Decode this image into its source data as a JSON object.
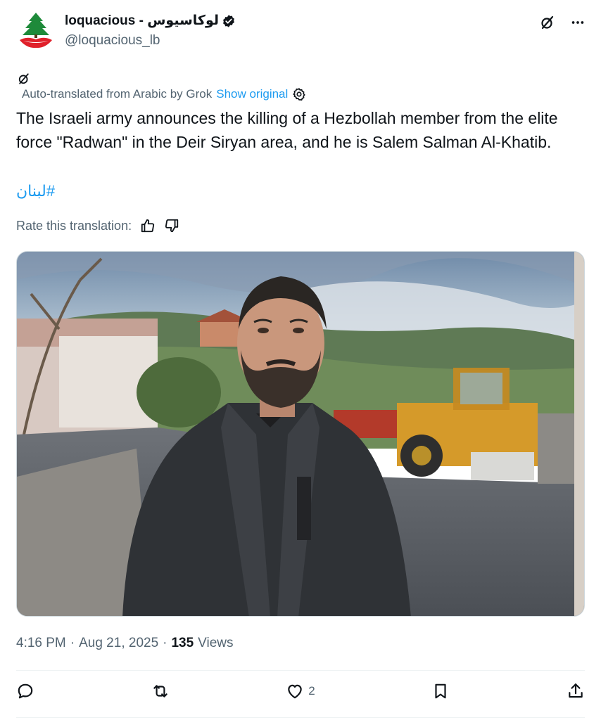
{
  "author": {
    "display_name": "loquacious - لوكاسيوس",
    "handle": "@loquacious_lb"
  },
  "icons": {
    "avatar": "lebanese-cedar-logo",
    "verified": "verified-badge-icon",
    "grok": "grok-icon",
    "more": "more-icon",
    "settings": "gear-icon"
  },
  "translation": {
    "label": "Auto-translated from Arabic by Grok",
    "show_original": "Show original",
    "text": "The Israeli army announces the killing of a Hezbollah member from the elite force \"Radwan\" in the Deir Siryan area, and he is Salem Salman Al-Khatib.",
    "hashtag": "#لبنان",
    "rate_label": "Rate this translation:"
  },
  "meta": {
    "time": "4:16 PM",
    "date": "Aug 21, 2025",
    "views_count": "135",
    "views_label": "Views"
  },
  "actions": {
    "likes": "2"
  },
  "colors": {
    "accent": "#1d9bf0",
    "secondary_text": "#536471",
    "primary_text": "#0f1419"
  }
}
